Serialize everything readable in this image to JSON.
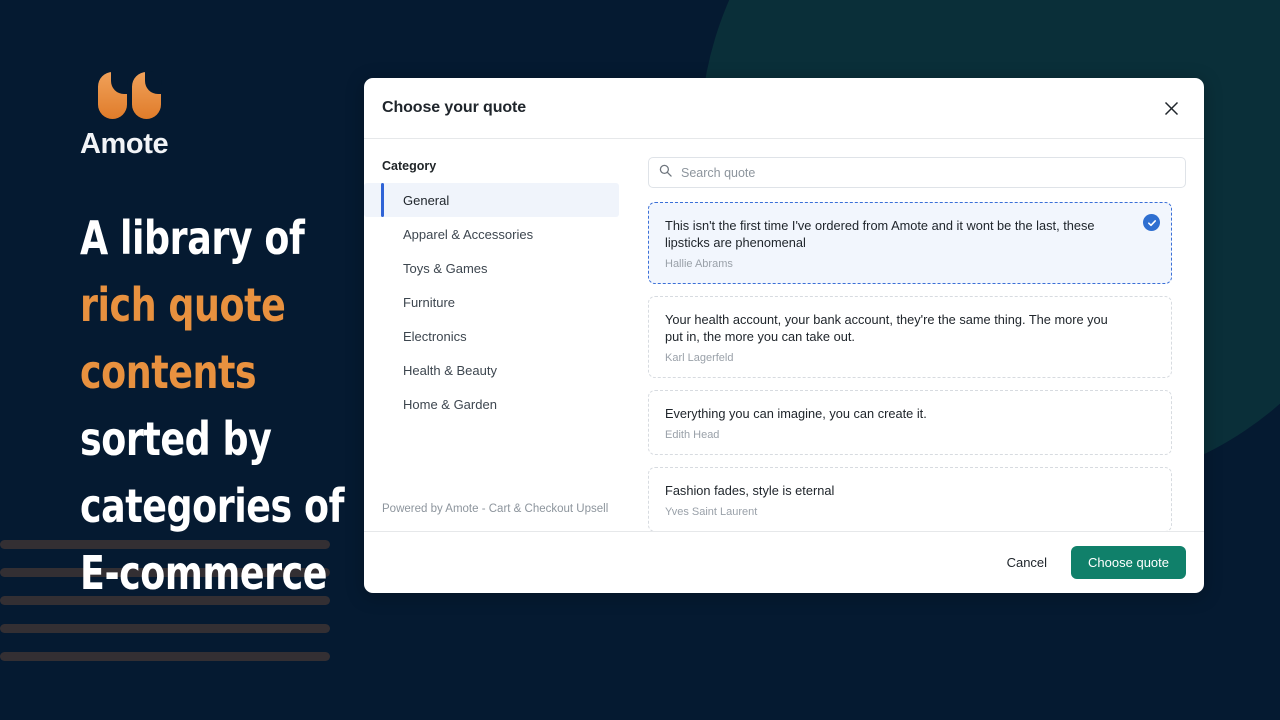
{
  "brand": {
    "name": "Amote",
    "logo_icon": "quote-marks-icon",
    "accent_color": "#e8913f"
  },
  "promo": {
    "lines": [
      {
        "text": "A library of",
        "accent": false
      },
      {
        "text": "rich quote",
        "accent": true
      },
      {
        "text": "contents",
        "accent": true
      },
      {
        "text": "sorted by",
        "accent": false
      },
      {
        "text": "categories of",
        "accent": false
      },
      {
        "text": "E-commerce",
        "accent": false
      }
    ]
  },
  "background": {
    "page_color": "#051a31",
    "circle_color": "#0a2f39",
    "bar_color": "#332f33",
    "bar_count": 5
  },
  "modal": {
    "title": "Choose your quote",
    "close_icon": "close-icon",
    "sidebar": {
      "label": "Category",
      "items": [
        {
          "label": "General",
          "selected": true
        },
        {
          "label": "Apparel & Accessories",
          "selected": false
        },
        {
          "label": "Toys & Games",
          "selected": false
        },
        {
          "label": "Furniture",
          "selected": false
        },
        {
          "label": "Electronics",
          "selected": false
        },
        {
          "label": "Health & Beauty",
          "selected": false
        },
        {
          "label": "Home & Garden",
          "selected": false
        }
      ],
      "powered_by": "Powered by Amote - Cart & Checkout Upsell"
    },
    "search": {
      "icon": "search-icon",
      "placeholder": "Search quote",
      "value": ""
    },
    "quotes": [
      {
        "text": "This isn't the first time I've ordered from Amote and it wont be the last, these lipsticks are phenomenal",
        "author": "Hallie Abrams",
        "selected": true
      },
      {
        "text": "Your health account, your bank account, they're the same thing. The more you put in, the more you can take out.",
        "author": "Karl Lagerfeld",
        "selected": false
      },
      {
        "text": "Everything you can imagine, you can create it.",
        "author": "Edith Head",
        "selected": false
      },
      {
        "text": "Fashion fades, style is eternal",
        "author": "Yves Saint Laurent",
        "selected": false
      }
    ],
    "footer": {
      "cancel_label": "Cancel",
      "confirm_label": "Choose quote",
      "confirm_color": "#10806a"
    }
  }
}
